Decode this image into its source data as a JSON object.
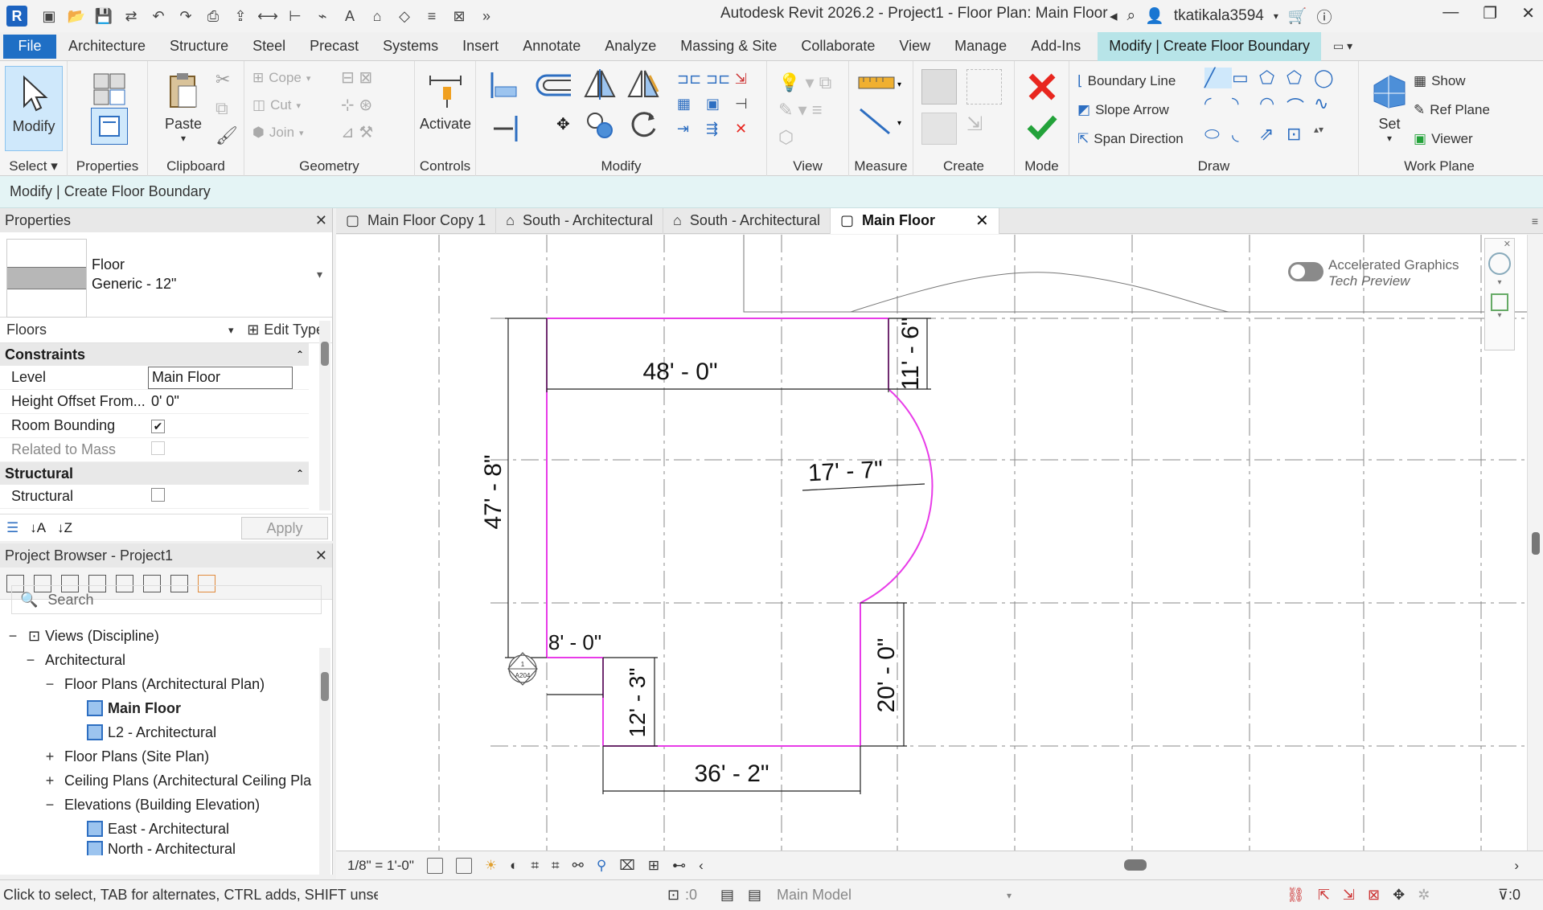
{
  "app": {
    "title": "Autodesk Revit 2026.2 - Project1 - Floor Plan: Main Floor",
    "user": "tkatikala3594",
    "logo_letter": "R"
  },
  "menu": {
    "file": "File",
    "tabs": [
      "Architecture",
      "Structure",
      "Steel",
      "Precast",
      "Systems",
      "Insert",
      "Annotate",
      "Analyze",
      "Massing & Site",
      "Collaborate",
      "View",
      "Manage",
      "Add-Ins"
    ],
    "active_tab": "Modify | Create Floor Boundary"
  },
  "ribbon": {
    "panels": {
      "select": "Select",
      "properties": "Properties",
      "clipboard": "Clipboard",
      "geometry": "Geometry",
      "controls": "Controls",
      "modify": "Modify",
      "view": "View",
      "measure": "Measure",
      "create": "Create",
      "mode": "Mode",
      "draw": "Draw",
      "work_plane": "Work Plane"
    },
    "modify_btn": "Modify",
    "paste_btn": "Paste",
    "activate_btn": "Activate",
    "geometry_items": [
      "Cope",
      "Cut",
      "Join"
    ],
    "draw_items": [
      "Boundary Line",
      "Slope Arrow",
      "Span Direction"
    ],
    "work_plane_items": [
      "Show",
      "Ref  Plane",
      "Viewer"
    ],
    "set_btn": "Set"
  },
  "context_bar": "Modify | Create Floor Boundary",
  "properties": {
    "title": "Properties",
    "type_family": "Floor",
    "type_name": "Generic - 12\"",
    "category": "Floors",
    "edit_type": "Edit Type",
    "groups": {
      "constraints": "Constraints",
      "structural": "Structural"
    },
    "rows": {
      "level_label": "Level",
      "level_value": "Main Floor",
      "offset_label": "Height Offset From...",
      "offset_value": "0'  0\"",
      "room_bounding_label": "Room Bounding",
      "related_mass_label": "Related to Mass",
      "structural_label": "Structural"
    },
    "checks": {
      "room_bounding": true,
      "related_to_mass": false,
      "structural": false
    },
    "apply": "Apply"
  },
  "browser": {
    "title": "Project Browser - Project1",
    "search_placeholder": "Search",
    "tree": {
      "root": "Views (Discipline)",
      "architectural": "Architectural",
      "floor_plans": "Floor Plans (Architectural Plan)",
      "main_floor": "Main Floor",
      "l2": "L2 - Architectural",
      "site_plans": "Floor Plans (Site Plan)",
      "ceiling_plans": "Ceiling Plans (Architectural Ceiling Pla",
      "elevations": "Elevations (Building Elevation)",
      "east": "East - Architectural",
      "north": "North - Architectural"
    }
  },
  "view_tabs": [
    "Main Floor Copy 1",
    "South - Architectural",
    "South - Architectural",
    "Main Floor"
  ],
  "canvas": {
    "accel_title": "Accelerated Graphics",
    "accel_sub": "Tech Preview",
    "dimensions": {
      "top_width": "48' - 0\"",
      "top_right": "11' - 6\"",
      "arc_radius": "17' - 7\"",
      "left_height": "47' - 8\"",
      "notch_width": "8' - 0\"",
      "notch_height": "12' - 3\"",
      "right_lower": "20' - 0\"",
      "bottom_width": "36' - 2\""
    },
    "elev_marker": "A204",
    "elev_number": "1"
  },
  "view_bar": {
    "scale": "1/8\" = 1'-0\""
  },
  "status": {
    "message": "Click to select, TAB for alternates, CTRL adds, SHIFT unselect",
    "worksets_count": ":0",
    "model": "Main Model",
    "filter_count": ":0"
  },
  "colors": {
    "sketch_line": "#e83ce8",
    "file_tab": "#1f6fc5",
    "context_tab": "#b7e4e8",
    "cancel": "#e8261f",
    "finish": "#23a23a"
  }
}
